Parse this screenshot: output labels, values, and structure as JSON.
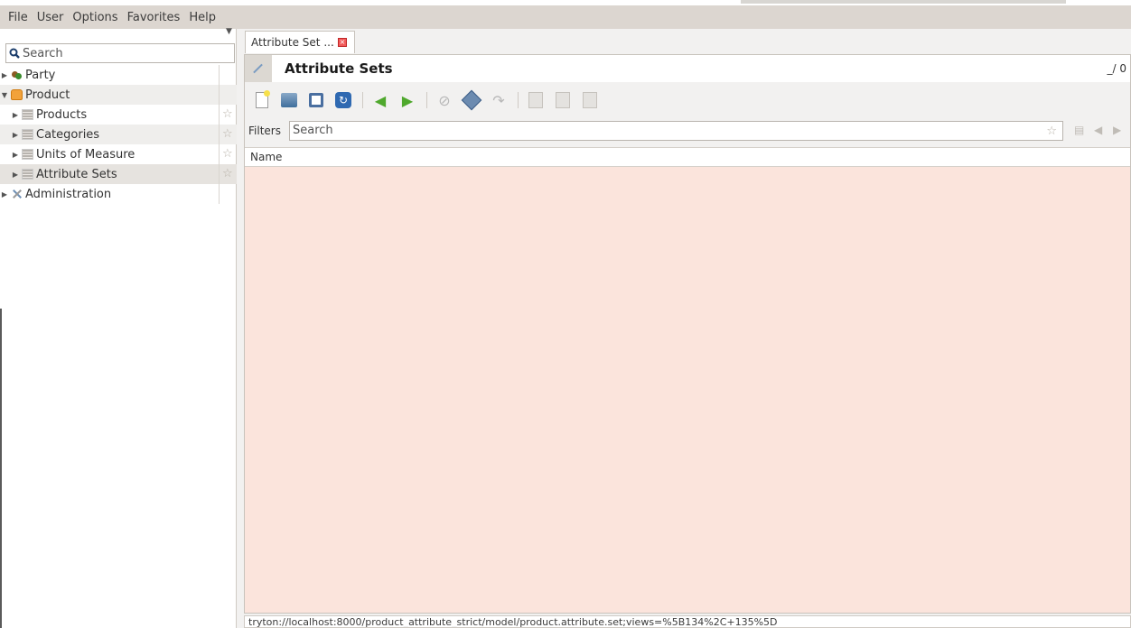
{
  "menubar": {
    "items": [
      "File",
      "User",
      "Options",
      "Favorites",
      "Help"
    ]
  },
  "sidebar": {
    "search_placeholder": "Search",
    "tree": [
      {
        "label": "Party",
        "icon": "party-icon",
        "expanded": false,
        "level": 0
      },
      {
        "label": "Product",
        "icon": "product-icon",
        "expanded": true,
        "level": 0
      },
      {
        "label": "Products",
        "icon": "list-icon",
        "expanded": false,
        "level": 1,
        "favorite": true
      },
      {
        "label": "Categories",
        "icon": "list-icon",
        "expanded": false,
        "level": 1,
        "favorite": true
      },
      {
        "label": "Units of Measure",
        "icon": "list-icon",
        "expanded": false,
        "level": 1,
        "favorite": true
      },
      {
        "label": "Attribute Sets",
        "icon": "list-icon",
        "expanded": false,
        "level": 1,
        "favorite": true,
        "selected": true
      },
      {
        "label": "Administration",
        "icon": "admin-icon",
        "expanded": false,
        "level": 0
      }
    ]
  },
  "tabs": [
    {
      "label": "Attribute Set ...",
      "active": true
    }
  ],
  "view": {
    "title": "Attribute Sets",
    "record_count": "_/ 0",
    "filter_label": "Filters",
    "filter_placeholder": "Search",
    "columns": [
      "Name"
    ]
  },
  "toolbar": {
    "buttons": [
      "new",
      "save",
      "switch",
      "reload",
      "previous",
      "next",
      "attachment",
      "action",
      "relate",
      "report",
      "email",
      "print"
    ]
  },
  "status": {
    "url": "tryton://localhost:8000/product_attribute_strict/model/product.attribute.set;views=%5B134%2C+135%5D"
  },
  "colors": {
    "grid_background": "#fbe4dc",
    "menubar": "#dcd6d0",
    "accent_green": "#4fa82d"
  }
}
